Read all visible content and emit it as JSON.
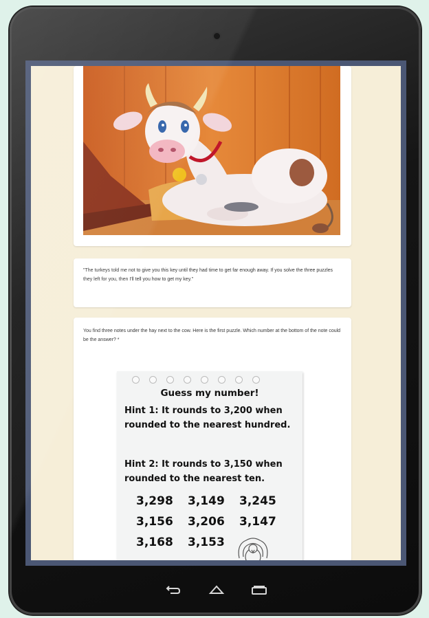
{
  "form": {
    "quote_text": "\"The turkeys told me not to give you this key until they had time to get far enough away. If you solve the three puzzles they left for you, then I'll tell you how to get my key.\"",
    "question_text": "You find three notes under the hay next to the cow. Here is the first puzzle. Which number at the bottom of the note could be the answer? *"
  },
  "note": {
    "title": "Guess my number!",
    "hint1": "Hint 1: It rounds to 3,200 when rounded to the nearest hundred.",
    "hint2": "Hint 2: It rounds to 3,150 when rounded to the nearest ten.",
    "numbers": [
      "3,298",
      "3,149",
      "3,245",
      "3,156",
      "3,206",
      "3,147",
      "3,168",
      "3,153"
    ]
  },
  "device": {
    "nav_icons": [
      "back-icon",
      "home-icon",
      "recent-apps-icon"
    ]
  }
}
